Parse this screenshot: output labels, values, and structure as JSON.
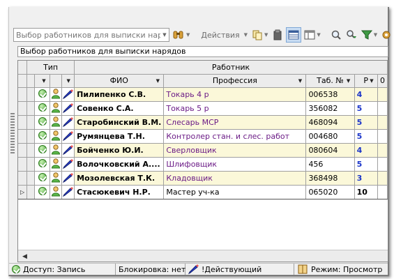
{
  "toolbar": {
    "combo_text": "Выбор работников для выписки нар",
    "actions_label": "Действия"
  },
  "caption": "Выбор работников для выписки нарядов",
  "grid": {
    "group_headers": {
      "type": "Тип",
      "worker": "Работник"
    },
    "columns": {
      "fio": "ФИО",
      "profession": "Профессия",
      "tab": "Таб. №",
      "rank": "Р",
      "extra": "0"
    },
    "rows": [
      {
        "fio": "Пилипенко С.В.",
        "profession": "Токарь 4 р",
        "tab": "006538",
        "rank": "4"
      },
      {
        "fio": "Совенко С.А.",
        "profession": "Токарь 5 р",
        "tab": "356082",
        "rank": "5"
      },
      {
        "fio": "Старобинский В.М.",
        "profession": "Слесарь МСР",
        "tab": "468094",
        "rank": "5"
      },
      {
        "fio": "Румянцева Т.Н.",
        "profession": "Контролер стан. и слес. работ",
        "tab": "004680",
        "rank": "5"
      },
      {
        "fio": "Бойченко Ю.И.",
        "profession": "Сверловщик",
        "tab": "080604",
        "rank": "4"
      },
      {
        "fio": "Волочковский А....",
        "profession": "Шлифовщик",
        "tab": "456",
        "rank": "5"
      },
      {
        "fio": "Мозолевская Т.К.",
        "profession": "Кладовщик",
        "tab": "368498",
        "rank": "3"
      },
      {
        "fio": "Стасюкевич Н.Р.",
        "profession": "Мастер уч-ка",
        "tab": "065020",
        "rank": "10"
      }
    ]
  },
  "status": {
    "access": "Доступ: Запись",
    "lock": "Блокировка: нет",
    "state": "!Действующий",
    "mode": "Режим: Просмотр"
  },
  "colors": {
    "row_highlight": "#fbf8d9",
    "profession_text": "#6b1b86",
    "rank_text": "#1b35c9"
  }
}
